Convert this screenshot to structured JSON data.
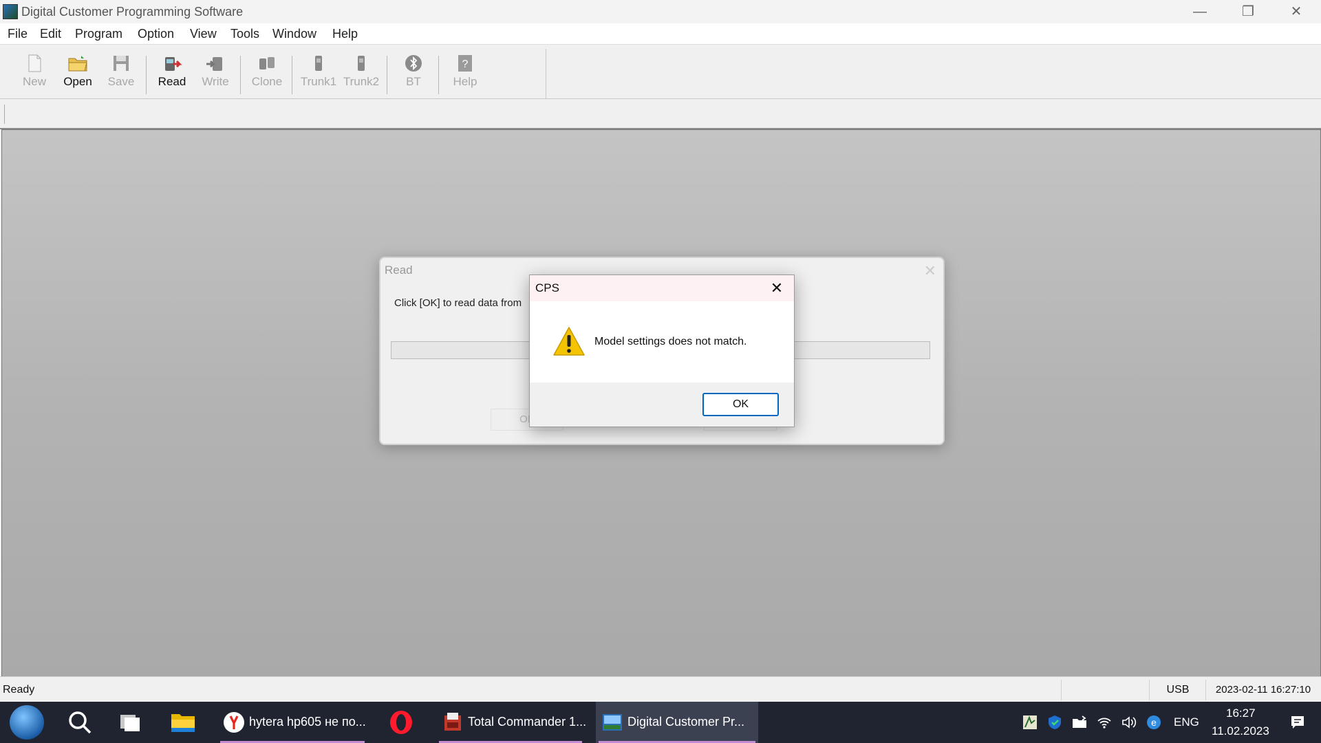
{
  "window": {
    "title": "Digital Customer Programming Software"
  },
  "menu": [
    "File",
    "Edit",
    "Program",
    "Option",
    "View",
    "Tools",
    "Window",
    "Help"
  ],
  "toolbar": {
    "buttons": [
      {
        "label": "New",
        "icon": "new-file-icon",
        "enabled": false
      },
      {
        "label": "Open",
        "icon": "open-folder-icon",
        "enabled": true
      },
      {
        "label": "Save",
        "icon": "save-icon",
        "enabled": false
      },
      {
        "label": "Read",
        "icon": "read-radio-icon",
        "enabled": true
      },
      {
        "label": "Write",
        "icon": "write-radio-icon",
        "enabled": false
      },
      {
        "label": "Clone",
        "icon": "clone-icon",
        "enabled": false
      },
      {
        "label": "Trunk1",
        "icon": "trunk1-icon",
        "enabled": false
      },
      {
        "label": "Trunk2",
        "icon": "trunk2-icon",
        "enabled": false
      },
      {
        "label": "BT",
        "icon": "bluetooth-icon",
        "enabled": false
      },
      {
        "label": "Help",
        "icon": "help-icon",
        "enabled": false
      }
    ]
  },
  "read_dialog": {
    "title": "Read",
    "message": "Click [OK] to read data from",
    "ok_label": "OK"
  },
  "message_box": {
    "title": "CPS",
    "message": "Model settings does not match.",
    "ok_label": "OK",
    "icon": "warning-icon"
  },
  "status": {
    "ready": "Ready",
    "connection": "USB",
    "datetime": "2023-02-11 16:27:10"
  },
  "taskbar": {
    "tasks": [
      {
        "label": "hytera hp605 не по...",
        "icon": "yandex-browser-icon"
      },
      {
        "label": "Total Commander 1...",
        "icon": "total-commander-icon"
      },
      {
        "label": "Digital Customer Pr...",
        "icon": "cps-app-icon"
      }
    ],
    "language": "ENG",
    "clock_time": "16:27",
    "clock_date": "11.02.2023"
  },
  "colors": {
    "accent": "#0067c0",
    "warning": "#f5c400",
    "taskbar": "#1f2430"
  }
}
